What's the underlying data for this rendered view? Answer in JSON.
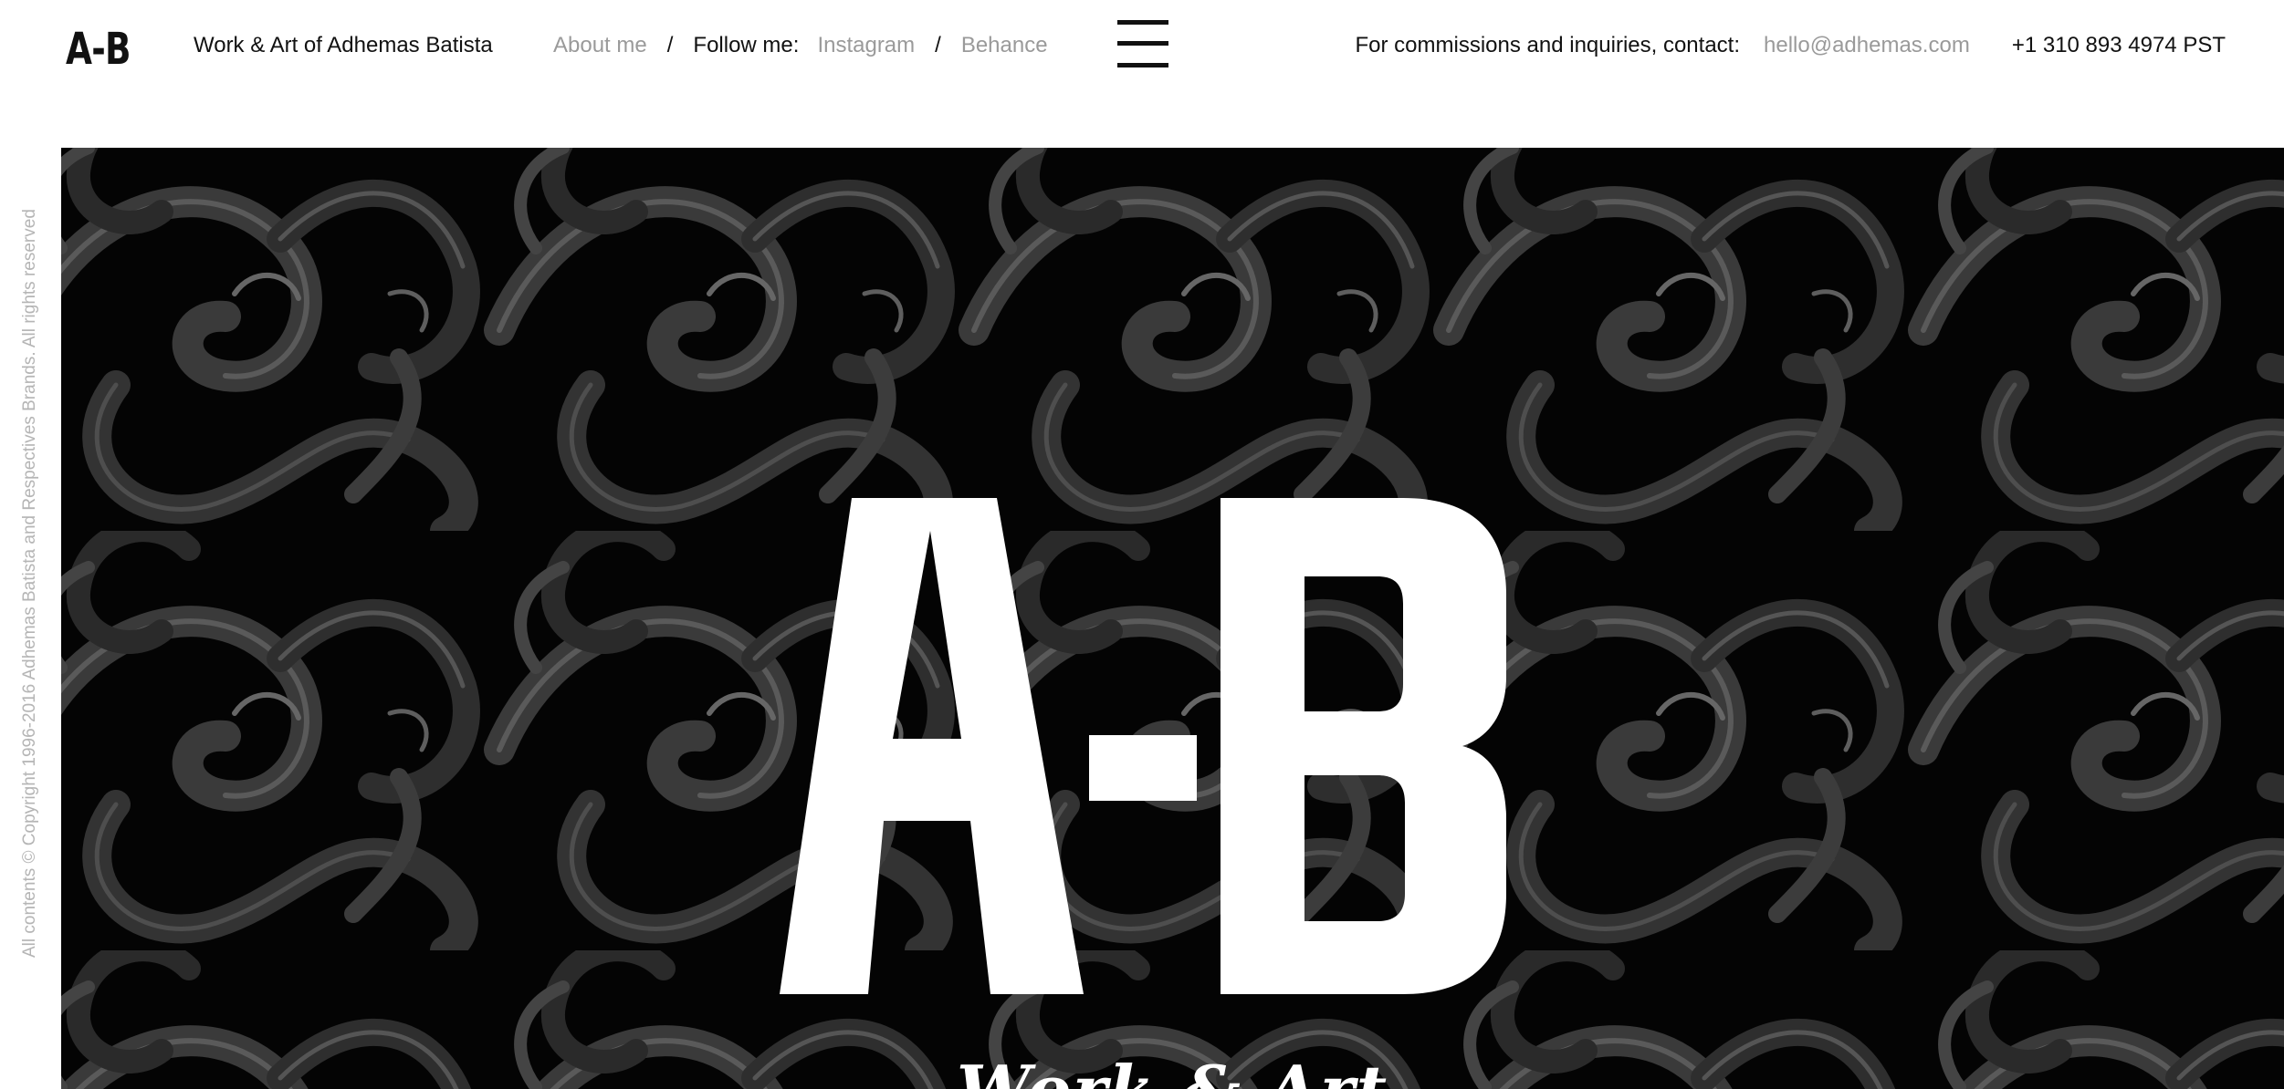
{
  "header": {
    "logo": "A-B",
    "site_title": "Work & Art of Adhemas Batista",
    "nav": {
      "about": "About me",
      "sep": "/",
      "follow_label": "Follow me:",
      "instagram": "Instagram",
      "behance": "Behance"
    },
    "menu_icon": "hamburger-menu-icon",
    "contact": {
      "label": "For commissions and inquiries, contact:",
      "email": "hello@adhemas.com",
      "phone": "+1 310 893 4974 PST"
    }
  },
  "sidebar": {
    "copyright": "All contents © Copyright 1996-2016 Adhemas Batista and Respectives Brands. All rights reserved"
  },
  "hero": {
    "mark": "A-B",
    "subtitle": "Work & Art"
  },
  "colors": {
    "text": "#111111",
    "muted_link": "#9a9a9a",
    "hero_bg": "#040404",
    "hero_mark": "#ffffff",
    "ornament": "#3a3a3a"
  }
}
